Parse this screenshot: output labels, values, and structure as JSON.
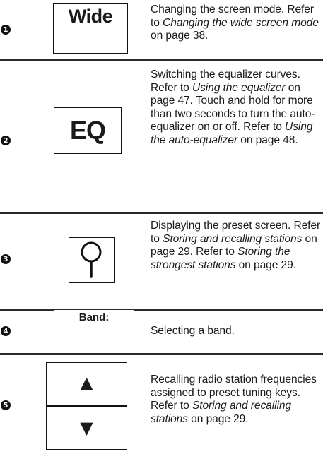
{
  "rows": [
    {
      "number": "1",
      "button": "Wide",
      "desc": [
        "Changing the screen mode.",
        "Refer to ",
        "Changing the wide screen mode",
        " on page 38."
      ]
    },
    {
      "number": "2",
      "button": "EQ",
      "desc": [
        "Switching the equalizer curves.",
        "Refer to ",
        "Using the equalizer",
        " on page 47.",
        "Touch and hold for more than two seconds to turn the auto-equalizer on or off.",
        "Refer to ",
        "Using the auto-equalizer",
        " on page 48."
      ]
    },
    {
      "number": "3",
      "button_icon": "preset-search-icon",
      "desc": [
        "Displaying the preset screen.",
        "Refer to ",
        "Storing and recalling stations",
        " on page 29.",
        "Refer to ",
        "Storing the strongest stations",
        " on page 29."
      ]
    },
    {
      "number": "4",
      "button": "Band:",
      "desc": [
        "Selecting a band."
      ]
    },
    {
      "number": "5",
      "button_up": "▲",
      "button_down": "▼",
      "button_icons": [
        "up-arrow-icon",
        "down-arrow-icon"
      ],
      "desc": [
        "Recalling radio station frequencies assigned to preset tuning keys.",
        "Refer to ",
        "Storing and recalling stations",
        " on page 29."
      ]
    }
  ]
}
